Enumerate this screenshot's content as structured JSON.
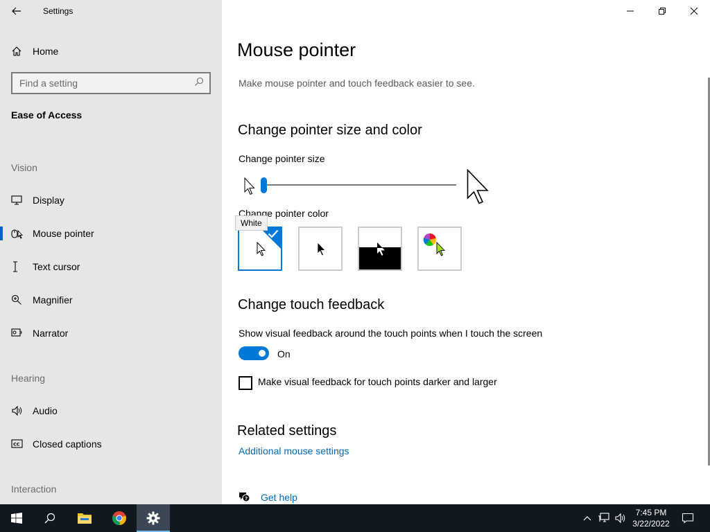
{
  "window": {
    "title": "Settings"
  },
  "sidebar": {
    "home_label": "Home",
    "search_placeholder": "Find a setting",
    "section_title": "Ease of Access",
    "group_vision": "Vision",
    "group_hearing": "Hearing",
    "group_interaction": "Interaction",
    "items": [
      {
        "label": "Display",
        "icon": "monitor-icon"
      },
      {
        "label": "Mouse pointer",
        "icon": "mouse-pointer-icon",
        "active": true
      },
      {
        "label": "Text cursor",
        "icon": "text-cursor-icon"
      },
      {
        "label": "Magnifier",
        "icon": "magnifier-icon"
      },
      {
        "label": "Narrator",
        "icon": "narrator-icon"
      },
      {
        "label": "Audio",
        "icon": "speaker-icon"
      },
      {
        "label": "Closed captions",
        "icon": "closed-captions-icon"
      }
    ]
  },
  "main": {
    "page_title": "Mouse pointer",
    "description": "Make mouse pointer and touch feedback easier to see.",
    "size_color_heading": "Change pointer size and color",
    "pointer_size_label": "Change pointer size",
    "pointer_size_level": 1,
    "pointer_color_label": "Change pointer color",
    "color_tooltip": "White",
    "color_options": [
      "White",
      "Black",
      "Inverted",
      "Custom"
    ],
    "selected_color": "White",
    "touch_heading": "Change touch feedback",
    "touch_feedback_label": "Show visual feedback around the touch points when I touch the screen",
    "toggle_state": "On",
    "darker_checkbox_label": "Make visual feedback for touch points darker and larger",
    "darker_checked": false,
    "related_heading": "Related settings",
    "related_link": "Additional mouse settings",
    "help_link": "Get help"
  },
  "taskbar": {
    "time": "7:45 PM",
    "date": "3/22/2022",
    "accent": "#0078d7"
  }
}
